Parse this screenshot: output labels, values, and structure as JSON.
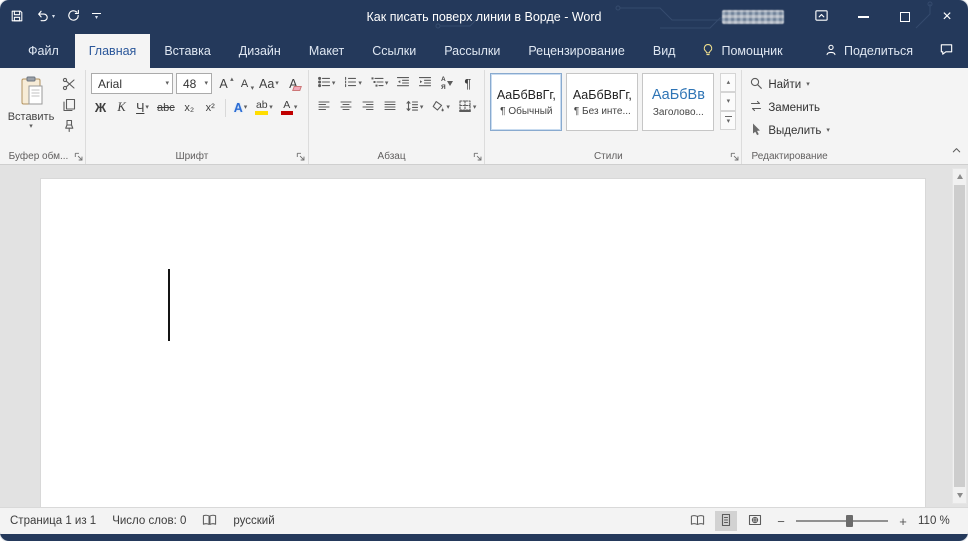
{
  "colors": {
    "titlebar_blue": "#24395b",
    "accent_blue": "#2b579a",
    "heading_blue": "#2e74b5",
    "highlight_yellow": "#ffdd00",
    "font_color_red": "#c00000",
    "ribbon_bg": "#f4f4f4",
    "canvas_gray": "#e2e2e2"
  },
  "titlebar": {
    "title": "Как писать поверх линии в Ворде - Word"
  },
  "tabs": {
    "file": "Файл",
    "items": [
      {
        "label": "Главная",
        "active": true
      },
      {
        "label": "Вставка",
        "active": false
      },
      {
        "label": "Дизайн",
        "active": false
      },
      {
        "label": "Макет",
        "active": false
      },
      {
        "label": "Ссылки",
        "active": false
      },
      {
        "label": "Рассылки",
        "active": false
      },
      {
        "label": "Рецензирование",
        "active": false
      },
      {
        "label": "Вид",
        "active": false
      }
    ],
    "assistant": "Помощник",
    "share": "Поделиться"
  },
  "ribbon": {
    "clipboard": {
      "paste_label": "Вставить",
      "group_label": "Буфер обм..."
    },
    "font": {
      "family_value": "Arial",
      "size_value": "48",
      "grow_letter": "А",
      "shrink_letter": "А",
      "case_label": "Aa",
      "clear_letter": "А",
      "bold": "Ж",
      "italic": "К",
      "underline": "Ч",
      "strike": "abc",
      "subscript": "x₂",
      "superscript": "x²",
      "effects_letter": "А",
      "highlight_label": "ab",
      "color_letter": "А",
      "group_label": "Шрифт"
    },
    "paragraph": {
      "sort_top": "А",
      "sort_bottom": "Я",
      "pilcrow": "¶",
      "group_label": "Абзац"
    },
    "styles": {
      "group_label": "Стили",
      "items": [
        {
          "preview": "АаБбВвГг,",
          "name": "¶ Обычный"
        },
        {
          "preview": "АаБбВвГг,",
          "name": "¶ Без инте..."
        },
        {
          "preview": "АаБбВв",
          "name": "Заголово..."
        }
      ]
    },
    "editing": {
      "find": "Найти",
      "replace": "Заменить",
      "select": "Выделить",
      "group_label": "Редактирование"
    }
  },
  "statusbar": {
    "page_info": "Страница 1 из 1",
    "word_count": "Число слов: 0",
    "language": "русский",
    "zoom_level": "110 %"
  },
  "glyphs": {
    "dropdown": "▾",
    "up": "▴",
    "close": "×",
    "minus": "−",
    "plus": "+"
  }
}
